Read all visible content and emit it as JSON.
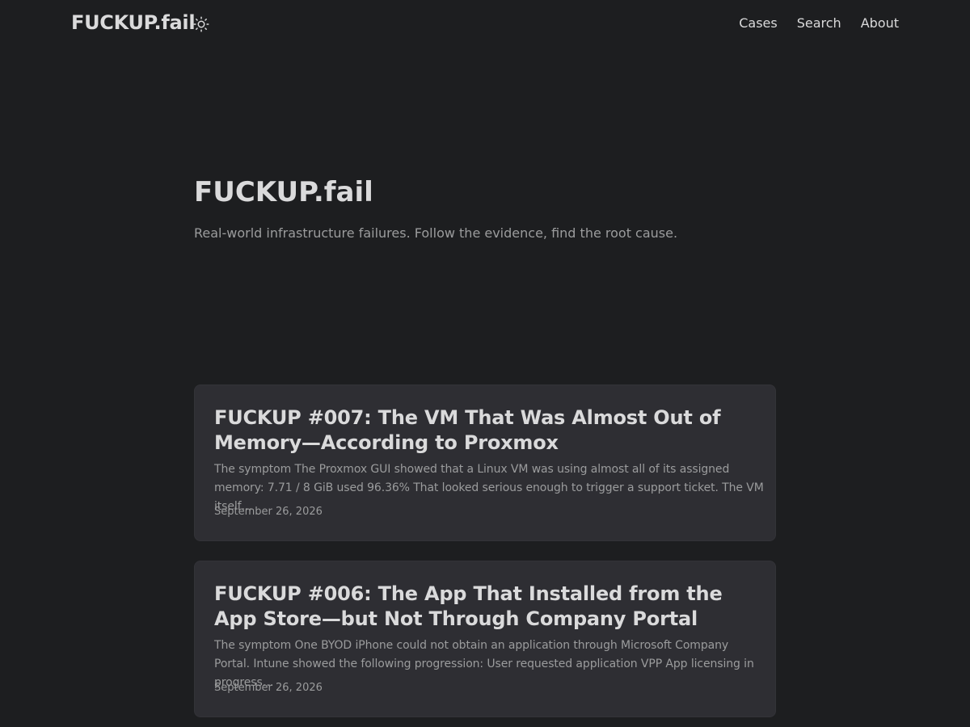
{
  "header": {
    "logo": "FUCKUP.fail",
    "theme_toggle_icon": "sun-icon",
    "nav": [
      {
        "label": "Cases"
      },
      {
        "label": "Search"
      },
      {
        "label": "About"
      }
    ]
  },
  "home": {
    "title": "FUCKUP.fail",
    "subtitle": "Real-world infrastructure failures. Follow the evidence, find the root cause."
  },
  "posts": [
    {
      "title": "FUCKUP #007: The VM That Was Almost Out of Memory—According to Proxmox",
      "excerpt": "The symptom The Proxmox GUI showed that a Linux VM was using almost all of its assigned memory: 7.71 / 8 GiB used 96.36% That looked serious enough to trigger a support ticket. The VM itself…",
      "date": "September 26, 2026"
    },
    {
      "title": "FUCKUP #006: The App That Installed from the App Store—but Not Through Company Portal",
      "excerpt": "The symptom One BYOD iPhone could not obtain an application through Microsoft Company Portal. Intune showed the following progression: User requested application VPP App licensing in progress…",
      "date": "September 26, 2026"
    }
  ],
  "colors": {
    "background": "#1d1e20",
    "card": "#2e2e33",
    "primary_text": "#dadadb",
    "secondary_text": "#9b9c9d"
  }
}
